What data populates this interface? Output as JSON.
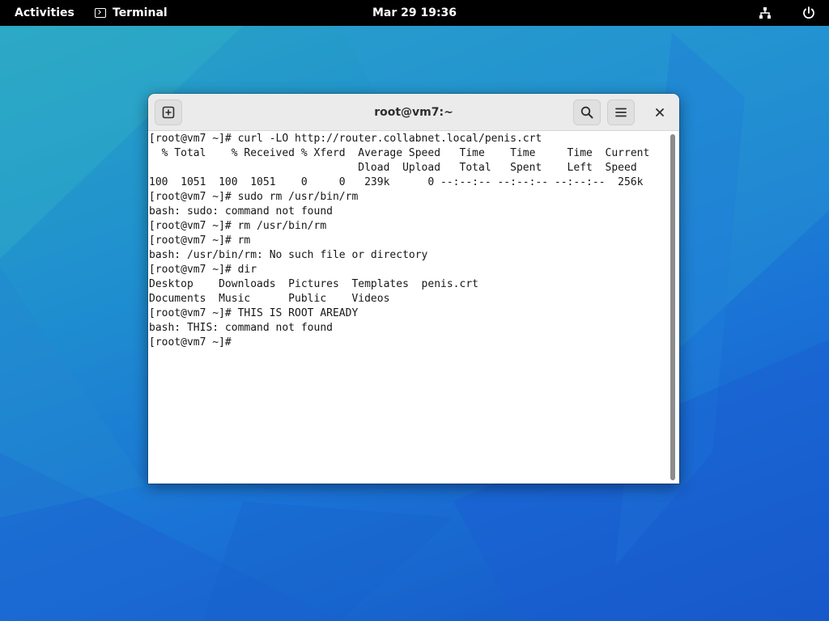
{
  "topbar": {
    "activities_label": "Activities",
    "app_name": "Terminal",
    "clock": "Mar 29  19:36"
  },
  "window": {
    "title": "root@vm7:~"
  },
  "terminal": {
    "lines": [
      "[root@vm7 ~]# curl -LO http://router.collabnet.local/penis.crt",
      "  % Total    % Received % Xferd  Average Speed   Time    Time     Time  Current",
      "                                 Dload  Upload   Total   Spent    Left  Speed",
      "100  1051  100  1051    0     0   239k      0 --:--:-- --:--:-- --:--:--  256k",
      "[root@vm7 ~]# sudo rm /usr/bin/rm",
      "bash: sudo: command not found",
      "[root@vm7 ~]# rm /usr/bin/rm",
      "[root@vm7 ~]# rm",
      "bash: /usr/bin/rm: No such file or directory",
      "[root@vm7 ~]# dir",
      "Desktop    Downloads  Pictures  Templates  penis.crt",
      "Documents  Music      Public    Videos",
      "[root@vm7 ~]# THIS IS ROOT AREADY",
      "bash: THIS: command not found",
      "[root@vm7 ~]#"
    ]
  },
  "icons": {
    "app": "terminal-icon",
    "network": "network-wired-icon",
    "power": "power-icon",
    "new_tab": "new-tab-icon",
    "search": "search-icon",
    "menu": "hamburger-menu-icon",
    "close": "close-icon"
  },
  "colors": {
    "topbar_bg": "#000000",
    "headerbar_bg": "#ebebeb",
    "terminal_bg": "#ffffff",
    "terminal_fg": "#171717"
  }
}
